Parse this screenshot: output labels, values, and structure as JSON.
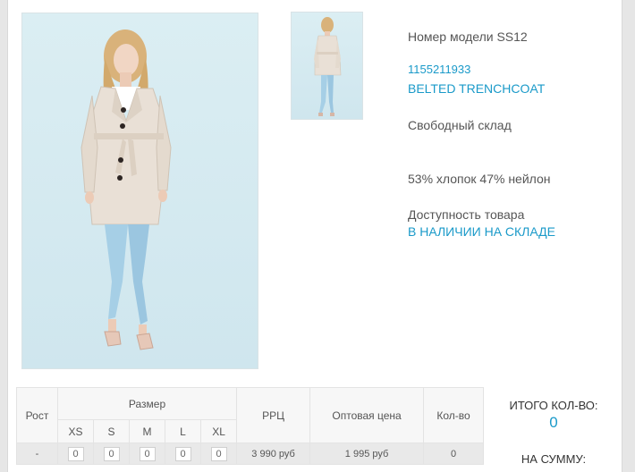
{
  "product": {
    "model_label": "Номер модели SS12",
    "article": "1155211933",
    "name": "BELTED TRENCHCOAT",
    "warehouse": "Свободный склад",
    "composition": "53% хлопок 47% нейлон",
    "availability_label": "Доступность товара",
    "availability_status": "В НАЛИЧИИ НА СКЛАДЕ",
    "main_image": "woman-in-beige-trenchcoat-front",
    "thumb_image": "woman-in-beige-trenchcoat-back"
  },
  "table": {
    "headers": {
      "height": "Рост",
      "size": "Размер",
      "rrp": "РРЦ",
      "wholesale": "Оптовая цена",
      "qty": "Кол-во"
    },
    "sizes": [
      "XS",
      "S",
      "M",
      "L",
      "XL"
    ],
    "row": {
      "height": "-",
      "size_qty": [
        "0",
        "0",
        "0",
        "0",
        "0"
      ],
      "rrp": "3 990 руб",
      "wholesale": "1 995 руб",
      "qty": "0"
    }
  },
  "totals": {
    "count_label": "ИТОГО КОЛ-ВО:",
    "count_value": "0",
    "sum_label": "НА СУММУ:"
  },
  "colors": {
    "accent": "#1a9ac9",
    "coat": "#e9e0d6",
    "jeans": "#9fc9e3",
    "backdrop": "#d6ebf1"
  }
}
